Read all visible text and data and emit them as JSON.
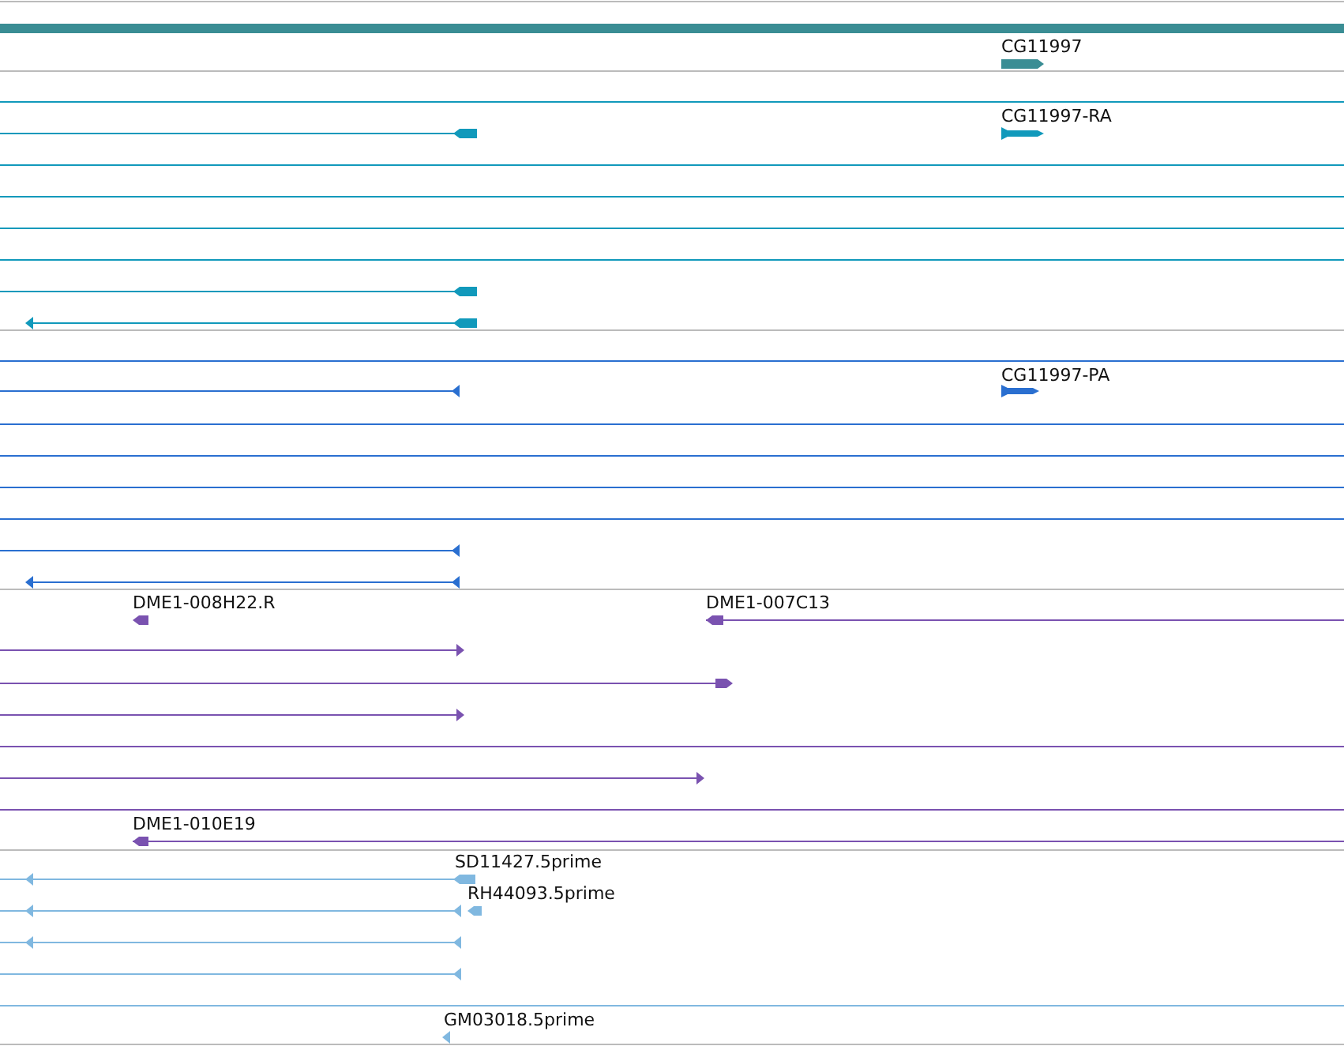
{
  "tracks": [
    {
      "kind": "gene",
      "color": "#3a8d94",
      "labels": [
        "CG11997"
      ]
    },
    {
      "kind": "mrna",
      "color": "#1199bb",
      "labels": [
        "CG11997-RA"
      ]
    },
    {
      "kind": "cds",
      "color": "#2a6fd0",
      "labels": [
        "CG11997-PA"
      ]
    },
    {
      "kind": "clone",
      "color": "#7a52b0",
      "labels": [
        "DME1-008H22.R",
        "DME1-007C13",
        "DME1-010E19"
      ]
    },
    {
      "kind": "est",
      "color": "#80b8e0",
      "labels": [
        "SD11427.5prime",
        "RH44093.5prime",
        "GM03018.5prime"
      ]
    }
  ]
}
